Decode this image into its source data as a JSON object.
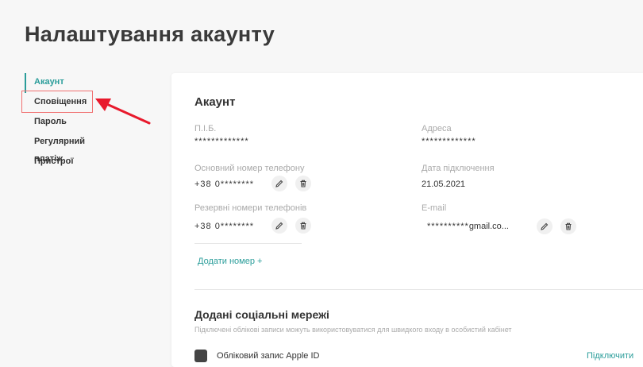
{
  "page": {
    "title": "Налаштування акаунту"
  },
  "sidebar": {
    "items": [
      {
        "label": "Акаунт",
        "active": true
      },
      {
        "label": "Сповіщення",
        "active": false
      },
      {
        "label": "Пароль",
        "active": false
      },
      {
        "label": "Регулярний платіж",
        "active": false
      },
      {
        "label": "Пристрої",
        "active": false
      }
    ]
  },
  "account": {
    "title": "Акаунт",
    "fio": {
      "label": "П.І.Б.",
      "value": "*************"
    },
    "address": {
      "label": "Адреса",
      "value": "*************"
    },
    "main_phone": {
      "label": "Основний номер телефону",
      "value": "+38 0********"
    },
    "connection_date": {
      "label": "Дата підключення",
      "value": "21.05.2021"
    },
    "reserve_phones": {
      "label": "Резервні номери телефонів",
      "value": "+38 0********"
    },
    "email": {
      "label": "E-mail",
      "masked": "**********",
      "domain": "gmail.co..."
    },
    "add_phone": "Додати номер +"
  },
  "social": {
    "title": "Додані соціальні мережі",
    "subtitle": "Підключені облікові записи можуть використовуватися для швидкого входу в особистий кабінет",
    "apple_label": "Обліковий запис Apple ID",
    "connect": "Підключити"
  },
  "colors": {
    "accent": "#2a9d9a",
    "annotation": "#e8192c"
  }
}
